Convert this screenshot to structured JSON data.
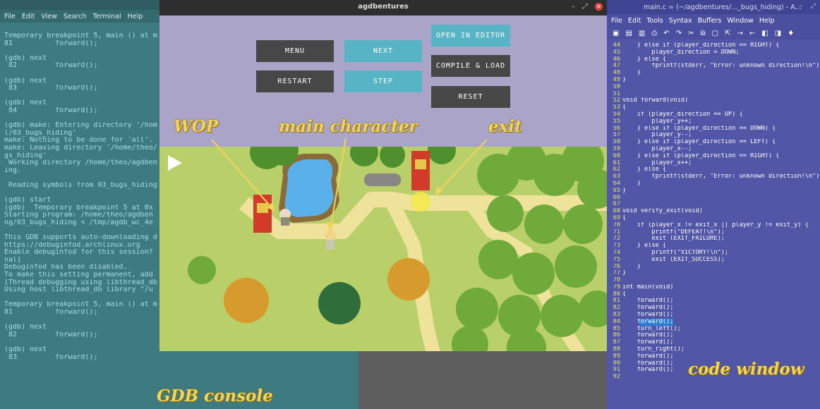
{
  "terminal": {
    "menu": [
      "File",
      "Edit",
      "View",
      "Search",
      "Terminal",
      "Help"
    ],
    "lines": [
      "Temporary breakpoint 5, main () at m",
      "81          forward();",
      "",
      "(gdb) next",
      " 82         forward();",
      "",
      "(gdb) next",
      " 83         forward();",
      "",
      "(gdb) next",
      " 84         forward();",
      "",
      "(gdb) make: Entering directory '/hom",
      "l/03_bugs_hiding'",
      "make: Nothing to be done for 'all'.",
      "make: Leaving directory '/home/theo/",
      "gs_hiding'",
      " Working directory /home/theo/agdben",
      "ing.",
      "",
      " Reading symbols from 03_bugs_hiding",
      "",
      "(gdb) start",
      "(gdb)  Temporary breakpoint 5 at 0x",
      "Starting program: /home/theo/agdben",
      "ng/03_bugs_hiding < /tmp/agdb_wc_4e",
      "",
      "This GDB supports auto-downloading d",
      "https://debuginfod.archlinux.org",
      "Enable debuginfod for this session?",
      "nal]",
      "Debuginfod has been disabled.",
      "To make this setting permanent, add",
      "[Thread debugging using libthread_db",
      "Using host libthread_db library \"/u",
      "",
      "Temporary breakpoint 5, main () at m",
      "81          forward();",
      "",
      "(gdb) next",
      " 82         forward();",
      "",
      "(gdb) next",
      " 83         forward();"
    ]
  },
  "game": {
    "title": "agdbentures",
    "buttons": {
      "menu": "MENU",
      "next": "NEXT",
      "open_in_editor": "OPEN IN EDITOR",
      "restart": "RESTART",
      "step": "STEP",
      "compile_load": "COMPILE & LOAD",
      "reset": "RESET"
    }
  },
  "code": {
    "title": "main.c = (~/agdbentures/..._bugs_hiding) - A...",
    "menu": [
      "File",
      "Edit",
      "Tools",
      "Syntax",
      "Buffers",
      "Window",
      "Help"
    ],
    "highlight_line": "84",
    "lines": [
      {
        "n": "44",
        "t": "    } else if (player_direction == RIGHT) {"
      },
      {
        "n": "45",
        "t": "        player_direction = DOWN;"
      },
      {
        "n": "46",
        "t": "    } else {"
      },
      {
        "n": "47",
        "t": "        fprintf(stderr, \"Error: unknown direction!\\n\");"
      },
      {
        "n": "48",
        "t": "    }"
      },
      {
        "n": "49",
        "t": "}"
      },
      {
        "n": "50",
        "t": ""
      },
      {
        "n": "51",
        "t": ""
      },
      {
        "n": "52",
        "t": "void forward(void)"
      },
      {
        "n": "53",
        "t": "{"
      },
      {
        "n": "54",
        "t": "    if (player_direction == UP) {"
      },
      {
        "n": "55",
        "t": "        player_y++;"
      },
      {
        "n": "56",
        "t": "    } else if (player_direction == DOWN) {"
      },
      {
        "n": "57",
        "t": "        player_y--;"
      },
      {
        "n": "58",
        "t": "    } else if (player_direction == LEFT) {"
      },
      {
        "n": "59",
        "t": "        player_x--;"
      },
      {
        "n": "60",
        "t": "    } else if (player_direction == RIGHT) {"
      },
      {
        "n": "61",
        "t": "        player_x++;"
      },
      {
        "n": "62",
        "t": "    } else {"
      },
      {
        "n": "63",
        "t": "        fprintf(stderr, \"Error: unknown direction!\\n\");"
      },
      {
        "n": "64",
        "t": "    }"
      },
      {
        "n": "65",
        "t": "}"
      },
      {
        "n": "66",
        "t": ""
      },
      {
        "n": "67",
        "t": ""
      },
      {
        "n": "68",
        "t": "void verify_exit(void)"
      },
      {
        "n": "69",
        "t": "{"
      },
      {
        "n": "70",
        "t": "    if (player_x != exit_x || player_y != exit_y) {"
      },
      {
        "n": "71",
        "t": "        printf(\"DEFEAT!\\n\");"
      },
      {
        "n": "72",
        "t": "        exit (EXIT_FAILURE);"
      },
      {
        "n": "73",
        "t": "    } else {"
      },
      {
        "n": "74",
        "t": "        printf(\"VICTORY!\\n\");"
      },
      {
        "n": "75",
        "t": "        exit (EXIT_SUCCESS);"
      },
      {
        "n": "76",
        "t": "    }"
      },
      {
        "n": "77",
        "t": "}"
      },
      {
        "n": "78",
        "t": ""
      },
      {
        "n": "79",
        "t": "int main(void)"
      },
      {
        "n": "80",
        "t": "{"
      },
      {
        "n": "81",
        "t": "    forward();"
      },
      {
        "n": "82",
        "t": "    forward();"
      },
      {
        "n": "83",
        "t": "    forward();"
      },
      {
        "n": "84",
        "t": "    forward();"
      },
      {
        "n": "85",
        "t": "    turn_left();"
      },
      {
        "n": "86",
        "t": "    forward();"
      },
      {
        "n": "87",
        "t": "    forward();"
      },
      {
        "n": "88",
        "t": "    turn_right();"
      },
      {
        "n": "89",
        "t": "    forward();"
      },
      {
        "n": "90",
        "t": "    forward();"
      },
      {
        "n": "91",
        "t": "    forward();"
      },
      {
        "n": "92",
        "t": ""
      }
    ]
  },
  "annotations": {
    "wop": "WOP",
    "main_character": "main character",
    "exit": "exit",
    "code_window": "code window",
    "gdb_console": "GDB console"
  },
  "colors": {
    "terminal_bg": "#3e7b80",
    "game_panel_bg": "#aaa5c8",
    "button_dark": "#474747",
    "button_teal": "#56b4c4",
    "code_bg": "#5156a6",
    "line_number": "#e8e07a",
    "annotation": "#f1d45a"
  }
}
